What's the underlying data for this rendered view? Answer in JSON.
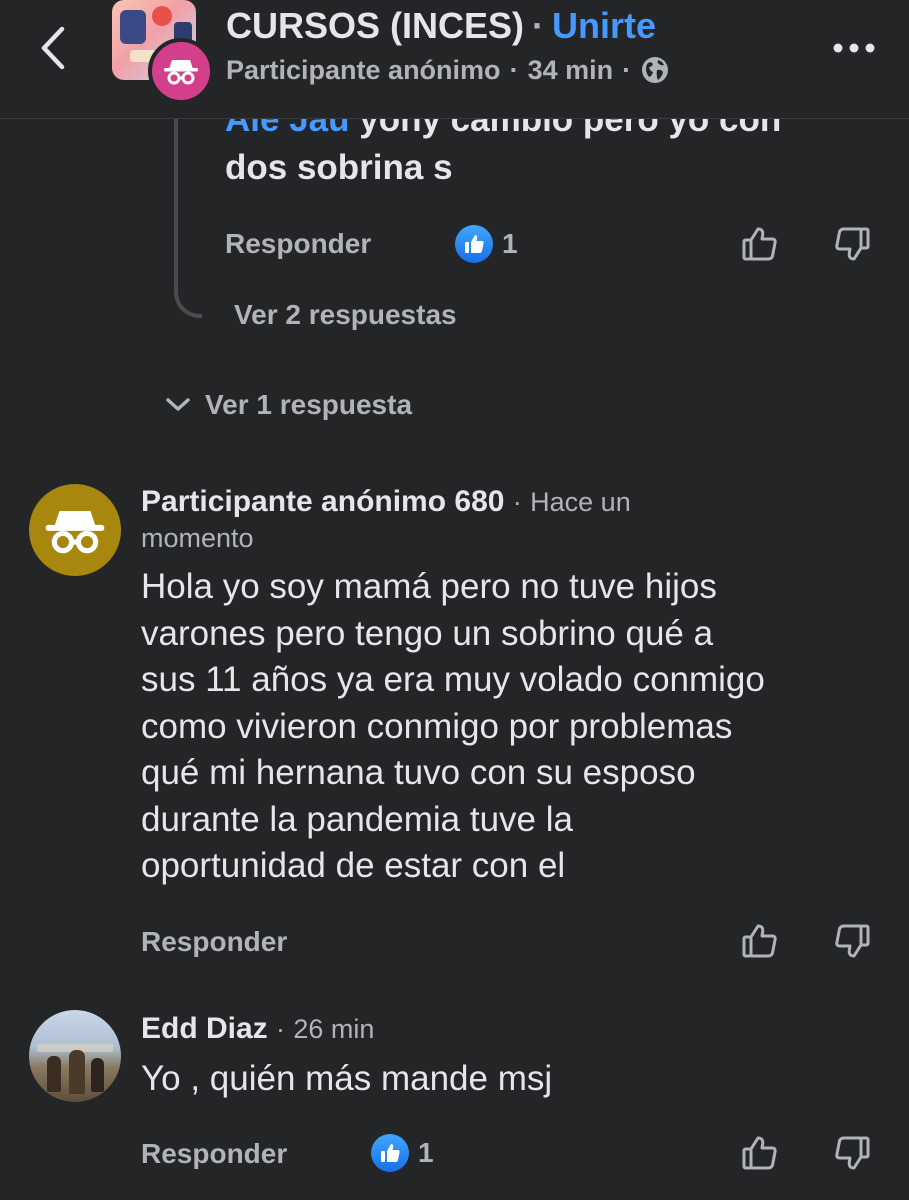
{
  "header": {
    "group_title": "CURSOS (INCES)",
    "separator": "·",
    "join_label": "Unirte",
    "author": "Participante anónimo",
    "time": "34 min",
    "privacy_icon": "globe-icon",
    "back_icon": "chevron-left-icon",
    "more_icon": "more-horizontal-icon"
  },
  "previous_reply": {
    "mention": "Ale Jau",
    "text_line1": " yony cambio pero yo con",
    "text_line2": "dos sobrina s",
    "reply_label": "Responder",
    "like_count": "1",
    "view_replies_label": "Ver 2 respuestas"
  },
  "view_one_reply_label": "Ver 1 respuesta",
  "comments": [
    {
      "author": "Participante anónimo 680",
      "time_line1": "Hace un",
      "time_line2": "momento",
      "avatar_icon": "anonymous-icon",
      "body_lines": [
        "Hola yo soy mamá pero no tuve hijos",
        "varones pero tengo un sobrino qué a",
        "sus 11 años ya era muy volado conmigo",
        "como vivieron conmigo por problemas",
        "qué mi hernana tuvo con su esposo",
        "durante la pandemia tuve la",
        "oportunidad de estar con el"
      ],
      "reply_label": "Responder"
    },
    {
      "author": "Edd Diaz",
      "time": "26 min",
      "body": "Yo , quién más mande msj",
      "reply_label": "Responder",
      "like_count": "1"
    }
  ],
  "colors": {
    "background": "#242526",
    "text_primary": "#e4e6eb",
    "text_secondary": "#b0b3b8",
    "link_blue": "#4599ff",
    "anon_badge": "#d43f8c",
    "anon_avatar": "#a8870e",
    "like_blue": "#1a6fe8"
  }
}
